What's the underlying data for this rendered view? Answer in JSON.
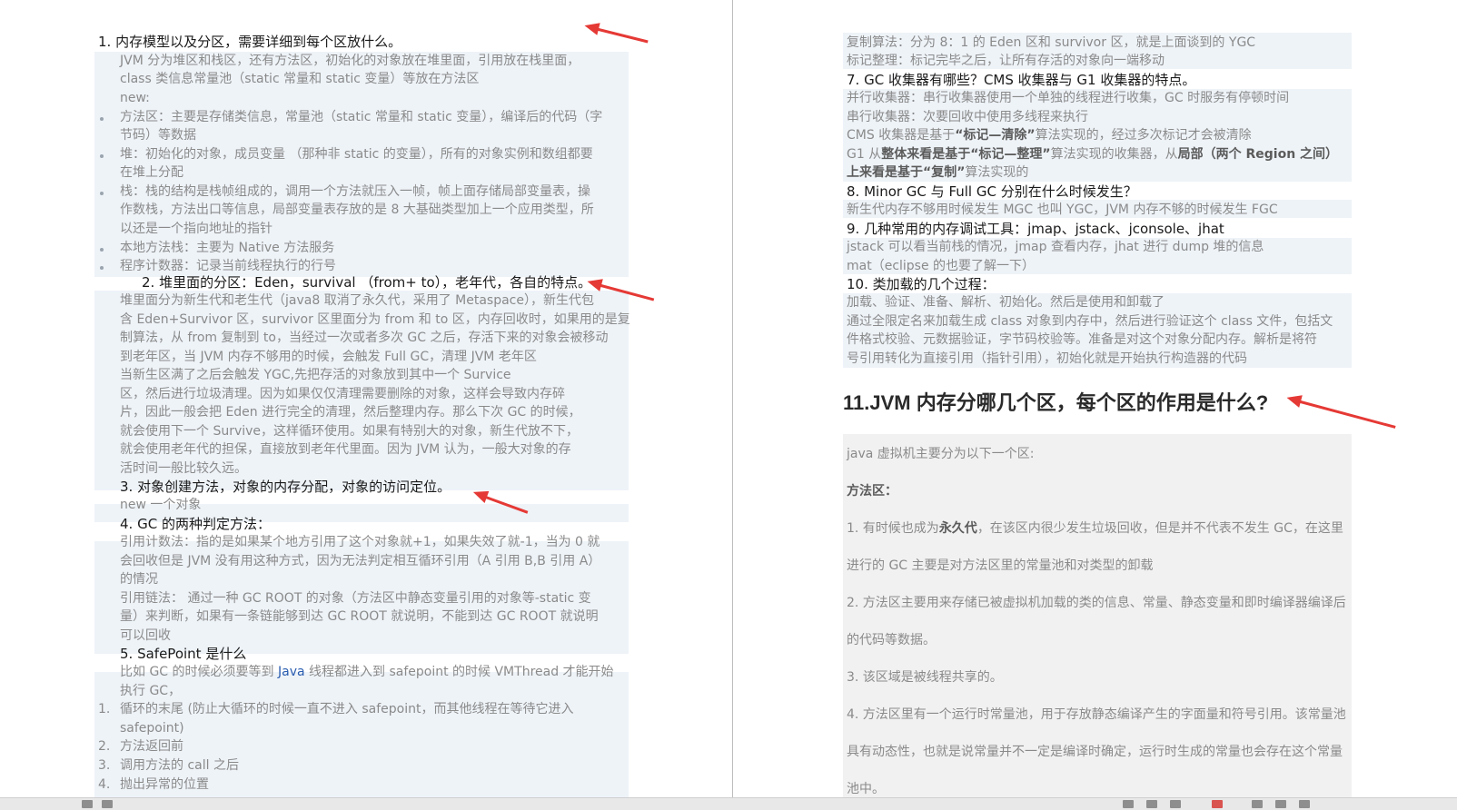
{
  "left_page": {
    "lines": [
      "1.   内存模型以及分区，需要详细到每个区放什么。",
      "JVM 分为堆区和栈区，还有方法区，初始化的对象放在堆里面，引用放在栈里面，",
      "class 类信息常量池（static 常量和 static 变量）等放在方法区",
      "new:",
      "方法区：主要是存储类信息，常量池（static 常量和 static 变量），编译后的代码（字",
      "节码）等数据",
      "堆：初始化的对象，成员变量 （那种非 static 的变量），所有的对象实例和数组都要",
      "在堆上分配",
      "栈：栈的结构是栈帧组成的，调用一个方法就压入一帧，帧上面存储局部变量表，操",
      "作数栈，方法出口等信息，局部变量表存放的是 8 大基础类型加上一个应用类型，所",
      "以还是一个指向地址的指针",
      "本地方法栈：主要为 Native 方法服务",
      "程序计数器：记录当前线程执行的行号",
      "2.   堆里面的分区：Eden，survival （from+ to），老年代，各自的特点。",
      "堆里面分为新生代和老生代（java8 取消了永久代，采用了 Metaspace），新生代包",
      "含 Eden+Survivor 区，survivor 区里面分为 from 和 to 区，内存回收时，如果用的是复",
      "制算法，从 from 复制到 to，当经过一次或者多次 GC 之后，存活下来的对象会被移动",
      "到老年区，当 JVM 内存不够用的时候，会触发 Full GC，清理 JVM 老年区",
      "当新生区满了之后会触发 YGC,先把存活的对象放到其中一个 Survice",
      "区，然后进行垃圾清理。因为如果仅仅清理需要删除的对象，这样会导致内存碎",
      "片，因此一般会把 Eden 进行完全的清理，然后整理内存。那么下次 GC 的时候，",
      "就会使用下一个 Survive，这样循环使用。如果有特别大的对象，新生代放不下，",
      "就会使用老年代的担保，直接放到老年代里面。因为 JVM 认为，一般大对象的存",
      "活时间一般比较久远。",
      "3.   对象创建方法，对象的内存分配，对象的访问定位。",
      "new 一个对象",
      "4.   GC 的两种判定方法：",
      "引用计数法：指的是如果某个地方引用了这个对象就+1，如果失效了就-1，当为 0 就",
      "会回收但是 JVM 没有用这种方式，因为无法判定相互循环引用（A 引用 B,B 引用 A）",
      "的情况",
      "引用链法：  通过一种 GC ROOT 的对象（方法区中静态变量引用的对象等-static 变",
      "量）来判断，如果有一条链能够到达 GC ROOT 就说明，不能到达 GC ROOT 就说明",
      "可以回收",
      "5.   SafePoint 是什么",
      "比如 GC 的时候必须要等到 ",
      "Java",
      " 线程都进入到 safepoint 的时候 VMThread 才能开始",
      "执行 GC，",
      "1.",
      "循环的末尾 (防止大循环的时候一直不进入 safepoint，而其他线程在等待它进入",
      "safepoint)",
      "2.",
      "方法返回前",
      "3.",
      "调用方法的 call 之后",
      "4.",
      "抛出异常的位置"
    ]
  },
  "right_page": {
    "lines": [
      "复制算法：分为 8：1 的 Eden 区和 survivor 区，就是上面谈到的 YGC",
      "标记整理：标记完毕之后，让所有存活的对象向一端移动",
      "7.   GC 收集器有哪些？CMS 收集器与 G1 收集器的特点。",
      "并行收集器：串行收集器使用一个单独的线程进行收集，GC 时服务有停顿时间",
      "串行收集器：次要回收中使用多线程来执行",
      "CMS 收集器是基于",
      "“标记—清除”",
      "算法实现的，经过多次标记才会被清除",
      "G1 从",
      "整体来看是基于“标记—整理”",
      "算法实现的收集器，从",
      "局部（两个 Region 之间）",
      "上来看是基于“复制”",
      "算法实现的",
      "8.   Minor GC 与 Full GC 分别在什么时候发生？",
      "新生代内存不够用时候发生 MGC 也叫 YGC，JVM 内存不够的时候发生 FGC",
      "9.   几种常用的内存调试工具：jmap、jstack、jconsole、jhat",
      "jstack 可以看当前栈的情况，jmap 查看内存，jhat 进行 dump 堆的信息",
      "mat（eclipse 的也要了解一下）",
      "10. 类加载的几个过程：",
      "加载、验证、准备、解析、初始化。然后是使用和卸载了",
      "通过全限定名来加载生成 class 对象到内存中，然后进行验证这个 class 文件，包括文",
      "件格式校验、元数据验证，字节码校验等。准备是对这个对象分配内存。解析是将符",
      "号引用转化为直接引用（指针引用），初始化就是开始执行构造器的代码",
      "11.JVM 内存分哪几个区，每个区的作用是什么?",
      "java 虚拟机主要分为以下一个区:",
      "方法区：",
      "1. 有时候也成为",
      "永久代",
      "，在该区内很少发生垃圾回收，但是并不代表不发生 GC，在这里",
      "进行的 GC 主要是对方法区里的常量池和对类型的卸载",
      "2. 方法区主要用来存储已被虚拟机加载的类的信息、常量、静态变量和即时编译器编译后",
      "的代码等数据。",
      "3. 该区域是被线程共享的。",
      "4. 方法区里有一个运行时常量池，用于存放静态编译产生的字面量和符号引用。该常量池",
      "具有动态性，也就是说常量并不一定是编译时确定，运行时生成的常量也会存在这个常量",
      "池中。"
    ]
  },
  "colors": {
    "annotation_arrow": "#e53935",
    "shade": "#eef3f8",
    "body_text": "#8a8a8a",
    "heading_text": "#1a1a1a"
  }
}
